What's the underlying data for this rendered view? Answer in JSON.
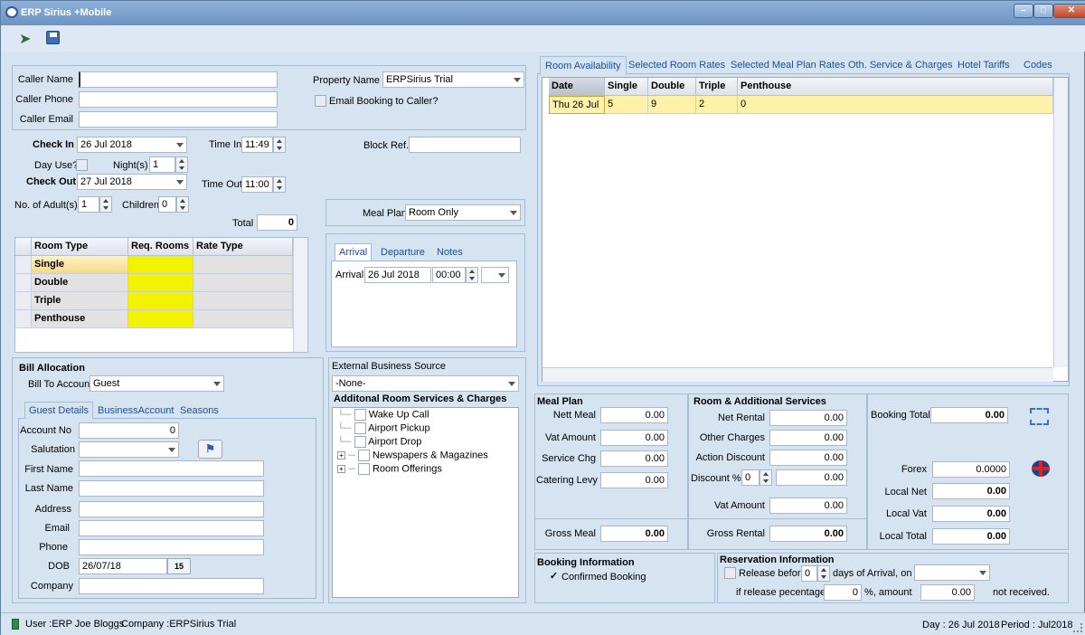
{
  "window": {
    "title": "ERP Sirius +Mobile"
  },
  "caller": {
    "name_label": "Caller Name",
    "phone_label": "Caller Phone",
    "email_label": "Caller Email",
    "property_label": "Property Name",
    "property_value": "ERPSirius Trial",
    "email_booking_label": "Email Booking to Caller?"
  },
  "stay": {
    "checkin_label": "Check In",
    "checkin_value": "26 Jul 2018",
    "timein_label": "Time In",
    "timein_value": "11:49",
    "blockref_label": "Block Ref.",
    "dayuse_label": "Day Use?",
    "nights_label": "Night(s)",
    "nights_value": "1",
    "checkout_label": "Check Out",
    "checkout_value": "27 Jul 2018",
    "timeout_label": "Time Out",
    "timeout_value": "11:00",
    "adults_label": "No. of Adult(s)",
    "adults_value": "1",
    "children_label": "Children",
    "children_value": "0",
    "total_label": "Total",
    "total_value": "0",
    "mealplan_label": "Meal Plan",
    "mealplan_value": "Room Only"
  },
  "room_grid": {
    "headers": [
      "Room Type",
      "Req. Rooms",
      "Rate Type"
    ],
    "rows": [
      "Single",
      "Double",
      "Triple",
      "Penthouse"
    ]
  },
  "arrival_tabs": {
    "tabs": [
      "Arrival",
      "Departure",
      "Notes"
    ],
    "arrival_label": "Arrival",
    "arrival_date": "26 Jul 2018",
    "arrival_time": "00:00"
  },
  "bill": {
    "section_label": "Bill Allocation",
    "bill_to_label": "Bill To Account",
    "bill_to_value": "Guest",
    "tabs": [
      "Guest Details",
      "BusinessAccount",
      "Seasons"
    ]
  },
  "guest": {
    "account_label": "Account No",
    "account_value": "0",
    "salutation_label": "Salutation",
    "firstname_label": "First Name",
    "lastname_label": "Last Name",
    "address_label": "Address",
    "email_label": "Email",
    "phone_label": "Phone",
    "dob_label": "DOB",
    "dob_value": "26/07/18",
    "company_label": "Company"
  },
  "business": {
    "source_label": "External Business Source",
    "source_value": "-None-",
    "services_label": "Additonal Room Services & Charges",
    "services": [
      {
        "label": "Wake Up Call",
        "expand": false
      },
      {
        "label": "Airport Pickup",
        "expand": false
      },
      {
        "label": "Airport Drop",
        "expand": false
      },
      {
        "label": "Newspapers & Magazines",
        "expand": true
      },
      {
        "label": "Room Offerings",
        "expand": true
      }
    ]
  },
  "availability": {
    "tabs": [
      "Room Availability",
      "Selected Room Rates",
      "Selected Meal Plan Rates",
      "Oth. Service & Charges",
      "Hotel Tariffs",
      "Codes"
    ],
    "headers": [
      "Date",
      "Single",
      "Double",
      "Triple",
      "Penthouse"
    ],
    "rows": [
      [
        "Thu 26 Jul",
        "5",
        "9",
        "2",
        "0"
      ]
    ]
  },
  "meal": {
    "section_label": "Meal Plan",
    "nett_label": "Nett Meal",
    "nett_value": "0.00",
    "vat_label": "Vat Amount",
    "vat_value": "0.00",
    "service_label": "Service Chg",
    "service_value": "0.00",
    "levy_label": "Catering Levy",
    "levy_value": "0.00",
    "gross_label": "Gross Meal",
    "gross_value": "0.00"
  },
  "room_services": {
    "section_label": "Room & Additional Services",
    "rental_label": "Net Rental",
    "rental_value": "0.00",
    "other_label": "Other Charges",
    "other_value": "0.00",
    "action_label": "Action Discount",
    "action_value": "0.00",
    "discount_label": "Discount %",
    "discount_pct": "0",
    "discount_value": "0.00",
    "vat_label": "Vat Amount",
    "vat_value": "0.00",
    "gross_label": "Gross Rental",
    "gross_value": "0.00"
  },
  "totals": {
    "booking_label": "Booking Total",
    "booking_value": "0.00",
    "forex_label": "Forex",
    "forex_value": "0.0000",
    "localnet_label": "Local Net",
    "localnet_value": "0.00",
    "localvat_label": "Local Vat",
    "localvat_value": "0.00",
    "localtotal_label": "Local Total",
    "localtotal_value": "0.00"
  },
  "booking_info": {
    "section_label": "Booking Information",
    "confirmed_label": "Confirmed Booking"
  },
  "reservation": {
    "section_label": "Reservation Information",
    "release_label": "Release before",
    "release_days": "0",
    "days_label": "days of Arrival, on",
    "pct_label": "if release pecentage",
    "pct_value": "0",
    "amount_label": "%, amount",
    "amount_value": "0.00",
    "not_received": "not received."
  },
  "status": {
    "user": "User :ERP Joe Bloggs",
    "company": "Company :ERPSirius Trial",
    "day": "Day : 26 Jul 2018",
    "period": "Period : Jul2018"
  },
  "colors": {
    "accent": "#1b4f9c",
    "highlight": "#fff2a8",
    "yellow": "#f3f300"
  }
}
